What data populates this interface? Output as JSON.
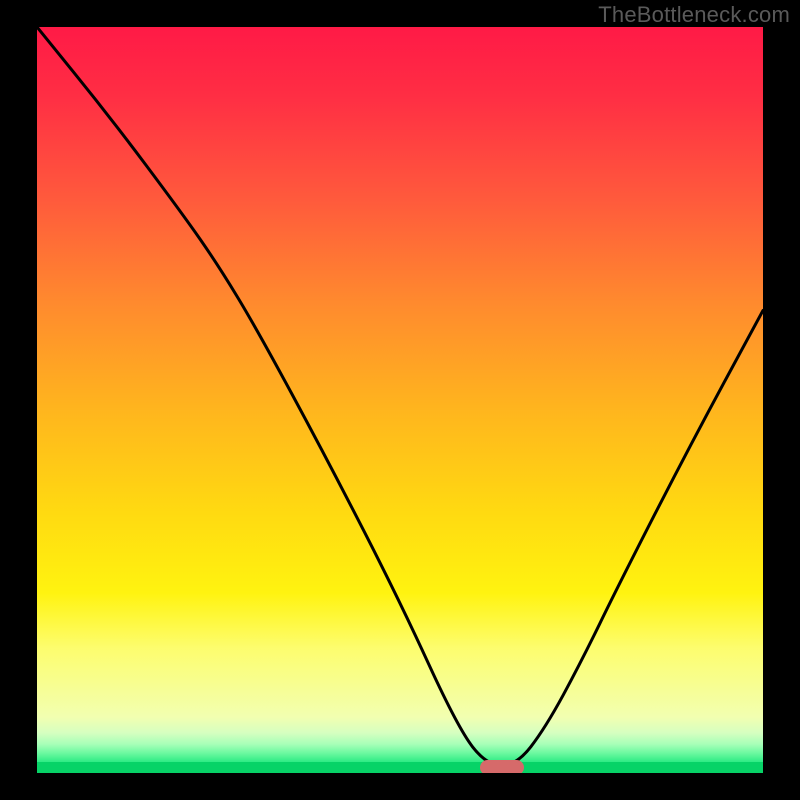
{
  "watermark": "TheBottleneck.com",
  "chart_data": {
    "type": "line",
    "title": "",
    "xlabel": "",
    "ylabel": "",
    "xlim": [
      0,
      100
    ],
    "ylim": [
      0,
      100
    ],
    "grid": false,
    "legend": false,
    "x": [
      0,
      10,
      20,
      25,
      30,
      40,
      50,
      58,
      62,
      66,
      70,
      75,
      80,
      90,
      100
    ],
    "values": [
      100,
      88,
      75,
      68,
      60,
      42,
      23,
      6,
      1,
      1,
      6,
      15,
      25,
      44,
      62
    ],
    "series_name": "bottleneck-curve",
    "minimum_marker": {
      "x": 64,
      "y": 0.5
    },
    "background": {
      "type": "vertical-gradient",
      "stops": [
        {
          "pos": 0,
          "color": "#ff1a46"
        },
        {
          "pos": 40,
          "color": "#ff8a2e"
        },
        {
          "pos": 70,
          "color": "#ffd911"
        },
        {
          "pos": 90,
          "color": "#fdfd6e"
        },
        {
          "pos": 98,
          "color": "#2eeb84"
        },
        {
          "pos": 100,
          "color": "#07d367"
        }
      ]
    }
  }
}
